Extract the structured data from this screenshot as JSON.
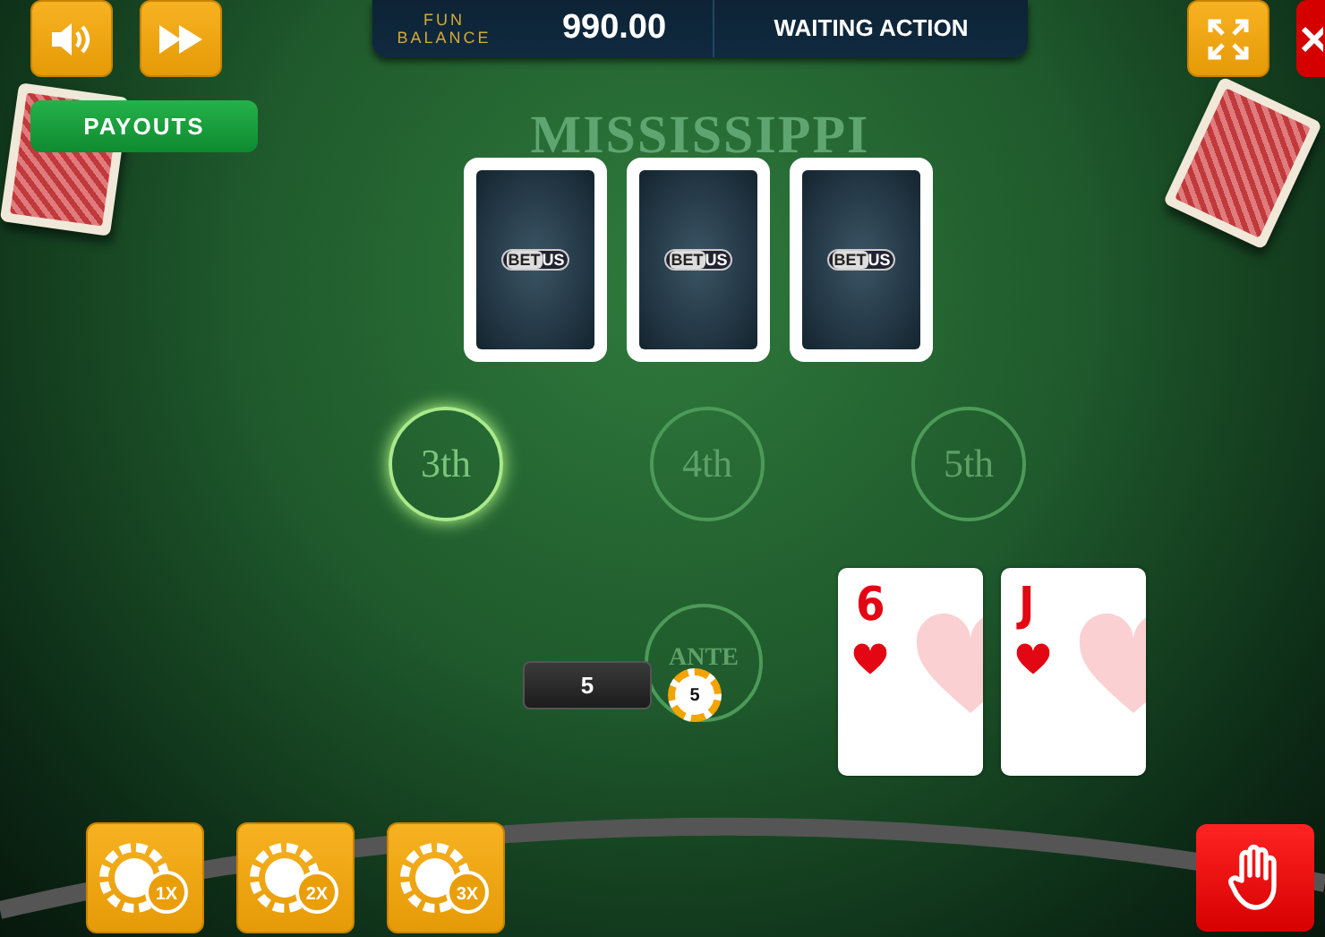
{
  "balance": {
    "label_lines": [
      "FUN",
      "BALANCE"
    ],
    "amount": "990.00",
    "status": "WAITING ACTION"
  },
  "payouts_button": "PAYOUTS",
  "table_title": "MISSISSIPPI",
  "dealer_cards": [
    {
      "logo_left": "BET",
      "logo_right": "US"
    },
    {
      "logo_left": "BET",
      "logo_right": "US"
    },
    {
      "logo_left": "BET",
      "logo_right": "US"
    }
  ],
  "bet_spots": [
    {
      "label": "3th",
      "selected": true
    },
    {
      "label": "4th",
      "selected": false
    },
    {
      "label": "5th",
      "selected": false
    }
  ],
  "ante": {
    "label": "ANTE",
    "bet_amount": "5",
    "chip_value": "5"
  },
  "player_cards": [
    {
      "rank": "6",
      "kind": "hearts"
    },
    {
      "rank": "J",
      "kind": "hearts"
    }
  ],
  "bet_buttons": [
    {
      "label": "1X"
    },
    {
      "label": "2X"
    },
    {
      "label": "3X"
    }
  ]
}
